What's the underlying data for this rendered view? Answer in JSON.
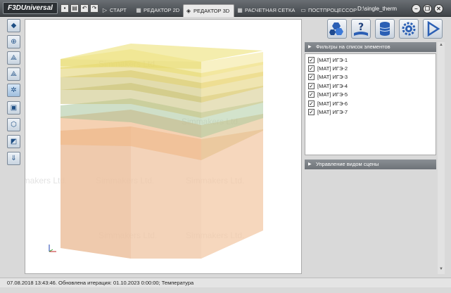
{
  "app": {
    "logo": "F3DUniversal",
    "project": "D:\\single_therm"
  },
  "quick_access": [
    {
      "icon": "save-icon",
      "glyph": "▪"
    },
    {
      "icon": "print-icon",
      "glyph": "▤"
    },
    {
      "icon": "undo-icon",
      "glyph": "↶"
    },
    {
      "icon": "redo-icon",
      "glyph": "↷"
    }
  ],
  "tabs": [
    {
      "label": "СТАРТ",
      "icon": "play-icon",
      "glyph": "▷"
    },
    {
      "label": "РЕДАКТОР 2D",
      "icon": "grid-icon",
      "glyph": "▦"
    },
    {
      "label": "РЕДАКТОР 3D",
      "icon": "cube-icon",
      "glyph": "◈"
    },
    {
      "label": "РАСЧЕТНАЯ СЕТКА",
      "icon": "mesh-icon",
      "glyph": "▦"
    },
    {
      "label": "ПОСТПРОЦЕССОР",
      "icon": "monitor-icon",
      "glyph": "▭"
    }
  ],
  "window_controls": [
    {
      "icon": "minimize-icon",
      "glyph": "–"
    },
    {
      "icon": "restore-icon",
      "glyph": "❐"
    },
    {
      "icon": "close-icon",
      "glyph": "✕"
    }
  ],
  "left_tools": [
    {
      "icon": "cube-view-icon",
      "glyph": "◆"
    },
    {
      "icon": "zoom-icon",
      "glyph": "⊕"
    },
    {
      "icon": "layers-icon",
      "glyph": "⟁"
    },
    {
      "icon": "layers-multi-icon",
      "glyph": "⟁"
    },
    {
      "icon": "select-icon",
      "glyph": "✲"
    },
    {
      "icon": "frame-icon",
      "glyph": "▣"
    },
    {
      "icon": "rotate-icon",
      "glyph": "⬡"
    },
    {
      "icon": "scale-icon",
      "glyph": "◩"
    },
    {
      "icon": "export-icon",
      "glyph": "⇓"
    }
  ],
  "right_tools": [
    {
      "icon": "hexagons-icon",
      "glyph": "⬢",
      "color": "#2b5fb4"
    },
    {
      "icon": "help-book-icon",
      "glyph": "?",
      "color": "#1e3f7a"
    },
    {
      "icon": "database-icon",
      "glyph": "≡",
      "color": "#2b5fb4"
    },
    {
      "icon": "settings-gear-icon",
      "glyph": "⚙",
      "color": "#2b5fb4"
    },
    {
      "icon": "run-icon",
      "glyph": "▷",
      "color": "#2b5fb4"
    }
  ],
  "filter_panel": {
    "title": "Фильтры на список элементов",
    "items": [
      {
        "label": "[МАТ] ИГЭ-1",
        "checked": "✓"
      },
      {
        "label": "[МАТ] ИГЭ-2",
        "checked": "✓"
      },
      {
        "label": "[МАТ] ИГЭ-3",
        "checked": "✓"
      },
      {
        "label": "[МАТ] ИГЭ-4",
        "checked": "✓"
      },
      {
        "label": "[МАТ] ИГЭ-5",
        "checked": "✓"
      },
      {
        "label": "[МАТ] ИГЭ-6",
        "checked": "✓"
      },
      {
        "label": "[МАТ] ИГЭ-7",
        "checked": "✓"
      }
    ]
  },
  "scene_panel": {
    "title": "Управление видом сцены"
  },
  "watermark": "Simmakers Ltd.",
  "status": "07.08.2018 13:43:46. Обновлена итерация: 01.10.2023 0:00:00; Температура",
  "colors": {
    "titlebar": "#4a4e52",
    "accent": "#2b5fb4"
  }
}
